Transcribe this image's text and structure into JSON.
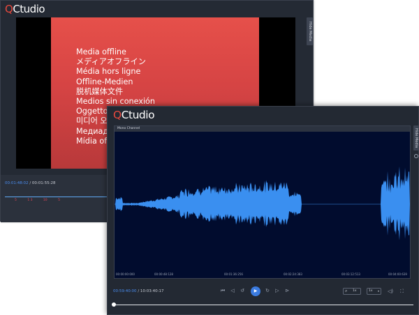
{
  "app": {
    "logo_q": "Q",
    "logo_rest": "Ctudio",
    "logo_dot": "•"
  },
  "colors": {
    "accent": "#4a8df0",
    "brand_red": "#e8483d",
    "waveform": "#3a8ff0",
    "wave_bg": "#010c2e"
  },
  "back_window": {
    "offline_messages": [
      "Media offline",
      "メディアオフライン",
      "Média hors ligne",
      "Offline-Medien",
      "脱机媒体文件",
      "Medios sin conexión",
      "Oggetto",
      "미디어 오",
      "Медиад",
      "Mídia of"
    ],
    "side_tab": "Hide Media",
    "time_current": "00:01:48:02",
    "time_sep": "/",
    "time_total": "00:01:55:28",
    "markers": [
      "5",
      "1 3",
      "10",
      "5"
    ]
  },
  "front_window": {
    "panel_title": "Mono Channel",
    "side_tab": "Hide Media",
    "ruler": [
      "00:00:00:000",
      "00:00:48:128",
      "00:01:36:256",
      "00:02:24:383",
      "00:03:12:513",
      "00:04:00:639"
    ],
    "time_current": "00:59:40:00",
    "time_sep": "/",
    "time_total": "10:03:40:17",
    "zoom_value": "1x",
    "speed_value": "1x",
    "playhead_progress": 0.0,
    "icons": {
      "prev": "skip-back-icon",
      "rewind": "rewind-icon",
      "loop": "loop-icon",
      "play": "play-icon",
      "forward": "forward-icon",
      "next": "skip-forward-icon",
      "marker": "marker-icon",
      "zoom": "search-icon",
      "volume": "speaker-icon",
      "fullscreen": "fullscreen-icon",
      "settings": "gear-icon"
    }
  }
}
